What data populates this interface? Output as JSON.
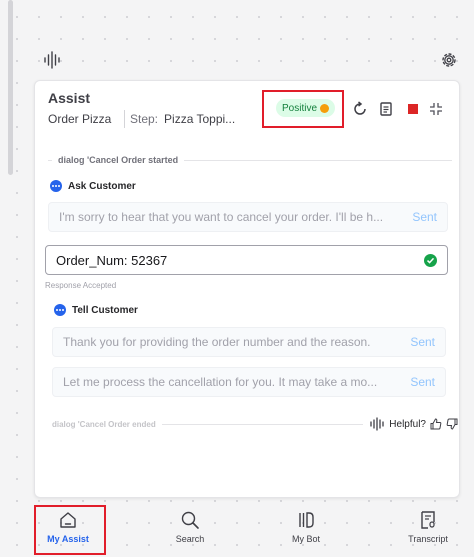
{
  "panel": {
    "title": "Assist",
    "order_label": "Order Pizza",
    "step_label": "Step:",
    "step_value": "Pizza Toppi...",
    "sentiment": "Positive"
  },
  "dialog": {
    "start_text": "dialog 'Cancel Order started",
    "end_text": "dialog 'Cancel Order ended",
    "helpful_label": "Helpful?"
  },
  "actions": [
    {
      "type": "Ask Customer",
      "message": "I'm sorry to hear that you want to cancel your order. I'll be h...",
      "status": "Sent"
    },
    {
      "type": "Tell Customer",
      "messages": [
        {
          "text": "Thank you for providing the order number and the reason.",
          "status": "Sent"
        },
        {
          "text": "Let me process the cancellation for you. It may take a mo...",
          "status": "Sent"
        }
      ]
    }
  ],
  "entity": {
    "value": "Order_Num: 52367",
    "status_text": "Response Accepted"
  },
  "nav": [
    {
      "label": "My Assist",
      "icon": "home-icon",
      "active": true
    },
    {
      "label": "Search",
      "icon": "search-icon",
      "active": false
    },
    {
      "label": "My Bot",
      "icon": "library-icon",
      "active": false
    },
    {
      "label": "Transcript",
      "icon": "transcript-icon",
      "active": false
    }
  ],
  "colors": {
    "accent": "#2563eb",
    "highlight": "#e11d2a",
    "positive_bg": "#dcfce7",
    "positive_fg": "#15803d",
    "stop": "#dc2626",
    "check": "#16a34a"
  }
}
